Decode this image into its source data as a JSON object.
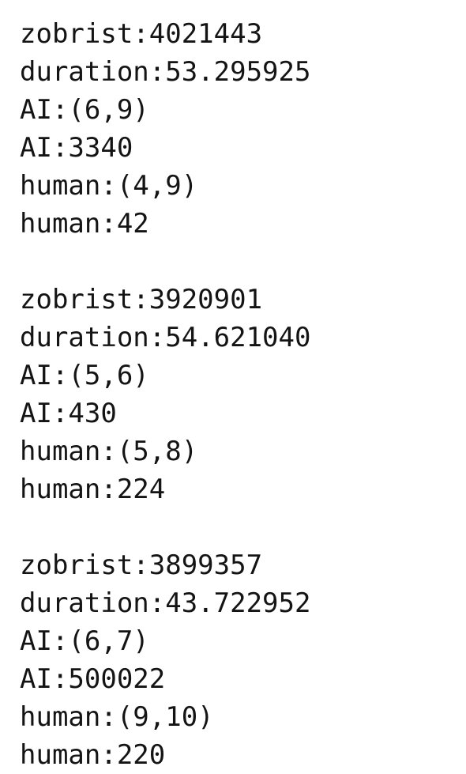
{
  "blocks": [
    {
      "lines": [
        "zobrist:4021443",
        "duration:53.295925",
        "AI:(6,9)",
        "AI:3340",
        "human:(4,9)",
        "human:42"
      ]
    },
    {
      "lines": [
        "zobrist:3920901",
        "duration:54.621040",
        "AI:(5,6)",
        "AI:430",
        "human:(5,8)",
        "human:224"
      ]
    },
    {
      "lines": [
        "zobrist:3899357",
        "duration:43.722952",
        "AI:(6,7)",
        "AI:500022",
        "human:(9,10)",
        "human:220"
      ]
    }
  ]
}
